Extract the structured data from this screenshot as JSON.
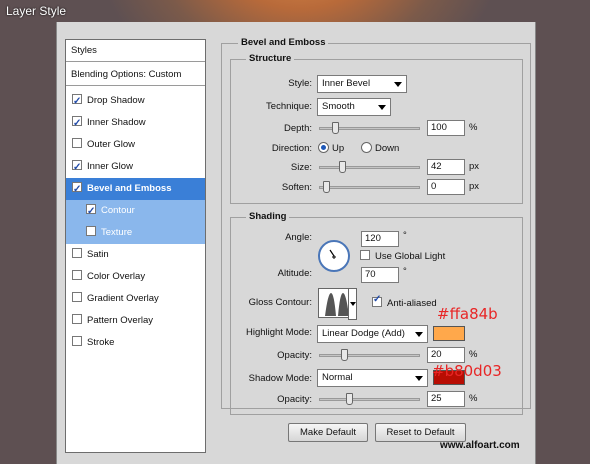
{
  "window": {
    "title": "Layer Style"
  },
  "styles_list": {
    "header": "Styles",
    "blending": "Blending Options: Custom",
    "items": [
      {
        "label": "Drop Shadow",
        "checked": true
      },
      {
        "label": "Inner Shadow",
        "checked": true
      },
      {
        "label": "Outer Glow",
        "checked": false
      },
      {
        "label": "Inner Glow",
        "checked": true
      },
      {
        "label": "Bevel and Emboss",
        "checked": true,
        "selected": true
      },
      {
        "label": "Contour",
        "checked": true,
        "sub": true
      },
      {
        "label": "Texture",
        "checked": false,
        "sub": true
      },
      {
        "label": "Satin",
        "checked": false
      },
      {
        "label": "Color Overlay",
        "checked": false
      },
      {
        "label": "Gradient Overlay",
        "checked": false
      },
      {
        "label": "Pattern Overlay",
        "checked": false
      },
      {
        "label": "Stroke",
        "checked": false
      }
    ]
  },
  "bevel": {
    "section_title": "Bevel and Emboss",
    "structure_title": "Structure",
    "style_label": "Style:",
    "style_value": "Inner Bevel",
    "technique_label": "Technique:",
    "technique_value": "Smooth",
    "depth_label": "Depth:",
    "depth_value": "100",
    "depth_unit": "%",
    "depth_pct": 0.1,
    "direction_label": "Direction:",
    "dir_up": "Up",
    "dir_down": "Down",
    "direction": "Up",
    "size_label": "Size:",
    "size_value": "42",
    "size_unit": "px",
    "size_pct": 0.17,
    "soften_label": "Soften:",
    "soften_value": "0",
    "soften_unit": "px",
    "soften_pct": 0.0
  },
  "shading": {
    "title": "Shading",
    "angle_label": "Angle:",
    "angle_value": "120",
    "angle_unit": "°",
    "global_light_label": "Use Global Light",
    "global_light": false,
    "altitude_label": "Altitude:",
    "altitude_value": "70",
    "altitude_unit": "°",
    "gloss_label": "Gloss Contour:",
    "anti_aliased_label": "Anti-aliased",
    "anti_aliased": true,
    "highlight_label": "Highlight Mode:",
    "highlight_value": "Linear Dodge (Add)",
    "highlight_color": "#ffa84b",
    "highlight_hex": "#ffa84b",
    "opacity1_label": "Opacity:",
    "opacity1_value": "20",
    "opacity1_unit": "%",
    "opacity1_pct": 0.2,
    "shadow_label": "Shadow Mode:",
    "shadow_value": "Normal",
    "shadow_color": "#b80d03",
    "shadow_hex": "#b80d03",
    "opacity2_label": "Opacity:",
    "opacity2_value": "25",
    "opacity2_unit": "%",
    "opacity2_pct": 0.25
  },
  "buttons": {
    "make_default": "Make Default",
    "reset_default": "Reset to Default"
  },
  "watermark": "www.alfoart.com"
}
